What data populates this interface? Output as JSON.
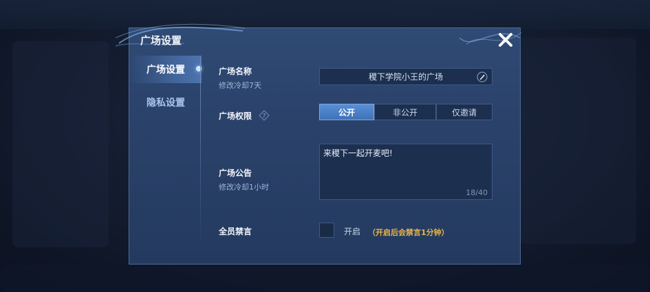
{
  "dialog": {
    "title": "广场设置",
    "close_icon": "close-icon"
  },
  "sidebar": {
    "items": [
      {
        "label": "广场设置",
        "active": true
      },
      {
        "label": "隐私设置",
        "active": false
      }
    ]
  },
  "plaza_name": {
    "label": "广场名称",
    "cooldown": "修改冷却7天",
    "value": "稷下学院小王的广场",
    "edit_icon": "pencil-icon"
  },
  "permission": {
    "label": "广场权限",
    "help_icon": "question-icon",
    "options": [
      "公开",
      "非公开",
      "仅邀请"
    ],
    "selected": "公开"
  },
  "announcement": {
    "label": "广场公告",
    "cooldown": "修改冷却1小时",
    "value": "来稷下一起开麦吧!",
    "char_count": "18/40"
  },
  "mute_all": {
    "label": "全员禁言",
    "toggle_label": "开启",
    "note": "（开启后会禁言1分钟）",
    "checked": false
  },
  "colors": {
    "accent": "#4f86cc",
    "panel": "#2a4169",
    "warning_text": "#e9b64a"
  }
}
